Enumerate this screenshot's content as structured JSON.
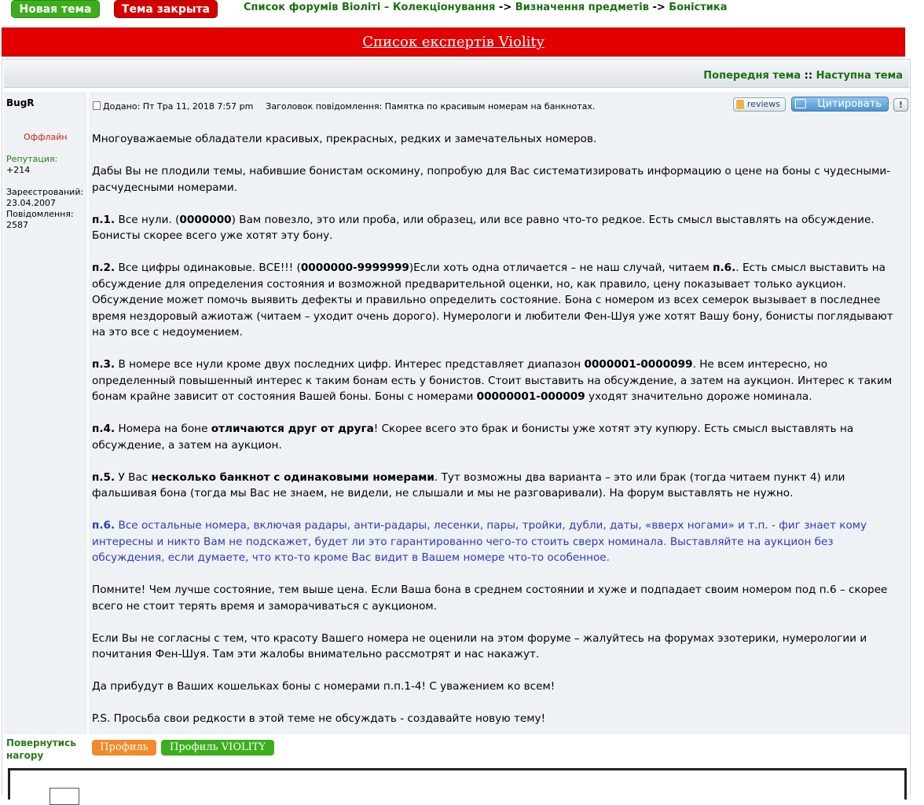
{
  "topbar": {
    "new_topic": "Новая тема",
    "topic_closed": "Тема закрыта",
    "breadcrumb": {
      "item1": "Список форумів Віоліті – Колекціонування",
      "item2": "Визначення предметів",
      "item3": "Боністика",
      "separator": "->"
    }
  },
  "experts_banner": "Список експертів Violity",
  "topic_nav": {
    "prev": "Попередня тема",
    "next": "Наступна тема",
    "separator": "::"
  },
  "author": {
    "name": "BugR",
    "status": "Оффлайн",
    "reputation_label": "Репутация:",
    "reputation_value": "+214",
    "registered_label": "Зареєстрований:",
    "registered_value": "23.04.2007",
    "posts_label": "Повідомлення:",
    "posts_value": "2587"
  },
  "post_header": {
    "added": "Додано: Пт Тра 11, 2018 7:57 pm",
    "subject": "Заголовок повідомлення: Памятка по красивым номерам на банкнотах."
  },
  "post_buttons": {
    "reviews": "reviews",
    "quote": "Цитировать",
    "info": "!"
  },
  "post": {
    "p0": "Многоуважаемые обладатели красивых, прекрасных, редких и замечательных номеров.",
    "p1": "Дабы Вы не плодили темы, набившие бонистам оскомину, попробую для Вас систематизировать информацию о цене на боны с чудесными-расчудесными номерами.",
    "p2_label": "п.1.",
    "p2_a": " Все нули. (",
    "p2_bold": "0000000",
    "p2_b": ") Вам повезло, это или проба, или образец, или все равно что-то редкое. Есть смысл выставлять на обсуждение. Бонисты скорее всего уже хотят эту бону.",
    "p3_label": "п.2.",
    "p3_a": " Все цифры одинаковые. ВСЕ!!! (",
    "p3_bold": "0000000-9999999",
    "p3_b": ")Если хоть одна отличается – не наш случай, читаем ",
    "p3_ref": "п.6.",
    "p3_c": ". Есть смысл выставить на обсуждение для определения состояния и возможной предварительной оценки, но, как правило, цену показывает только аукцион. Обсуждение может помочь выявить дефекты и правильно определить состояние. Бона с номером из всех семерок вызывает в последнее время нездоровый ажиотаж (читаем – уходит очень дорого). Нумерологи и любители Фен-Шуя уже хотят Вашу бону, бонисты поглядывают на это все с недоумением.",
    "p4_label": "п.3.",
    "p4_a": " В номере все нули кроме двух последних цифр. Интерес представляет диапазон ",
    "p4_bold1": "0000001-0000099",
    "p4_b": ". Не всем интересно, но определенный повышенный интерес к таким бонам есть у бонистов. Стоит выставить на обсуждение, а затем на аукцион. Интерес к таким бонам крайне зависит от состояния Вашей боны. Боны с номерами ",
    "p4_bold2": "00000001-000009",
    "p4_c": " уходят значительно дороже номинала.",
    "p5_label": "п.4.",
    "p5_a": " Номера на боне ",
    "p5_bold": "отличаются друг от друга",
    "p5_b": "! Скорее всего это брак и бонисты уже хотят эту купюру. Есть смысл выставлять на обсуждение, а затем на аукцион.",
    "p6_label": "п.5.",
    "p6_a": " У Вас ",
    "p6_bold": "несколько банкнот с одинаковыми номерами",
    "p6_b": ". Тут возможны два варианта – это или брак (тогда читаем пункт 4) или фальшивая бона (тогда мы Вас не знаем, не видели, не слышали и мы не разговаривали). На форум выставлять не нужно.",
    "p7_label": "п.6.",
    "p7_text": " Все остальные номера, включая радары, анти-радары, лесенки, пары, тройки, дубли, даты, «вверх ногами» и т.п. - фиг знает кому интересны и никто Вам не подскажет, будет ли это гарантированно чего-то стоить сверх номинала. Выставляйте на аукцион без обсуждения, если думаете, что кто-то кроме Вас видит в Вашем номере что-то особенное.",
    "p8": "Помните! Чем лучше состояние, тем выше цена. Если Ваша бона в среднем состоянии и хуже и подпадает своим номером под п.6 – скорее всего не стоит терять время и заморачиваться с аукционом.",
    "p9": "Если Вы не согласны с тем, что красоту Вашего номера не оценили на этом форуме – жалуйтесь на форумах эзотерики, нумерологии и почитания Фен-Шуя. Там эти жалобы внимательно рассмотрят и нас накажут.",
    "p10": "Да прибудут в Ваших кошельках боны с номерами п.п.1-4! С уважением ко всем!",
    "p11": "P.S. Просьба свои редкости в этой теме не обсуждать - создавайте новую тему!"
  },
  "footer": {
    "back_to_top": "Повернутись нагору",
    "profile": "Профиль",
    "profile_violity": "Профиль VIOLITY"
  },
  "colors": {
    "accent_green": "#3cae1e",
    "accent_red": "#e20000",
    "link_green": "#1a6e10",
    "quote_blue": "#2b3cbc"
  }
}
